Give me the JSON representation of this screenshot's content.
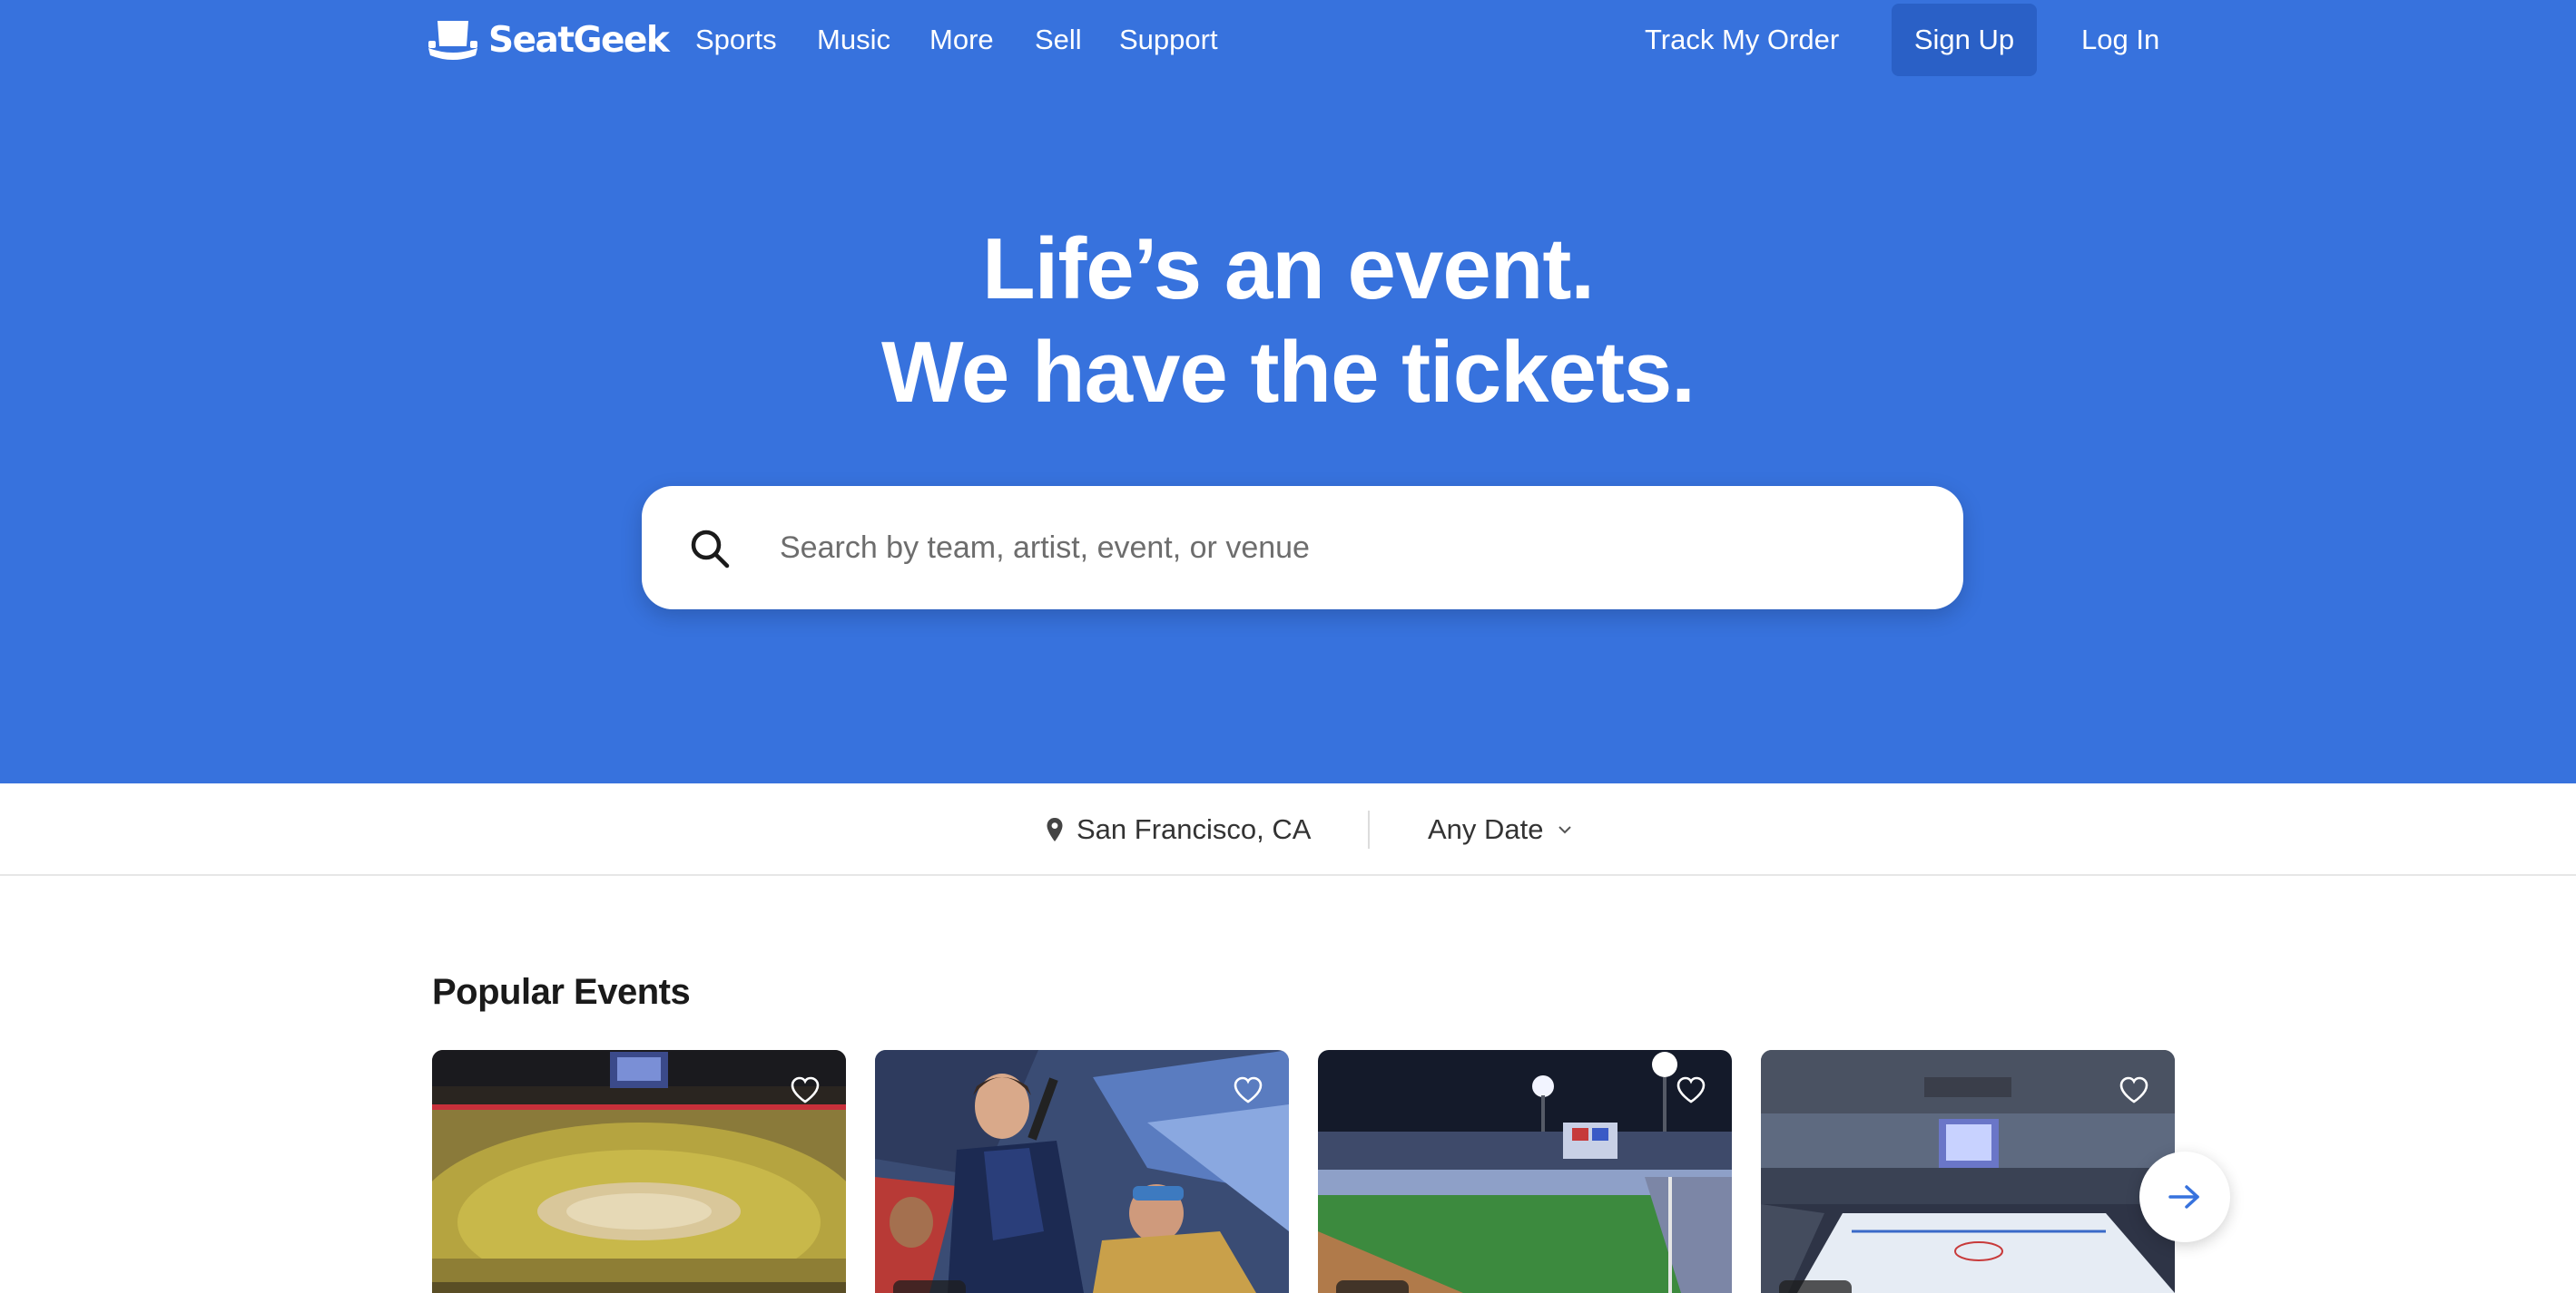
{
  "brand": {
    "name": "SeatGeek",
    "color": "#3772dd",
    "accent_dark": "#2a60c6"
  },
  "nav": {
    "left": [
      "Sports",
      "Music",
      "More",
      "Sell",
      "Support"
    ],
    "track_order": "Track My Order",
    "signup": "Sign Up",
    "login": "Log In"
  },
  "hero": {
    "headline_line1": "Life’s an event.",
    "headline_line2": "We have the tickets."
  },
  "search": {
    "placeholder": "Search by team, artist, event, or venue",
    "value": ""
  },
  "filters": {
    "location": "San Francisco, CA",
    "date": "Any Date"
  },
  "popular": {
    "title": "Popular Events",
    "cards": [
      {
        "image": "basketball-arena-crowd"
      },
      {
        "image": "rock-concert-performers"
      },
      {
        "image": "baseball-stadium-night"
      },
      {
        "image": "hockey-arena-rink"
      }
    ]
  },
  "icons": [
    "logo-hat-icon",
    "search-icon",
    "location-pin-icon",
    "chevron-down-icon",
    "heart-icon",
    "arrow-right-icon"
  ]
}
